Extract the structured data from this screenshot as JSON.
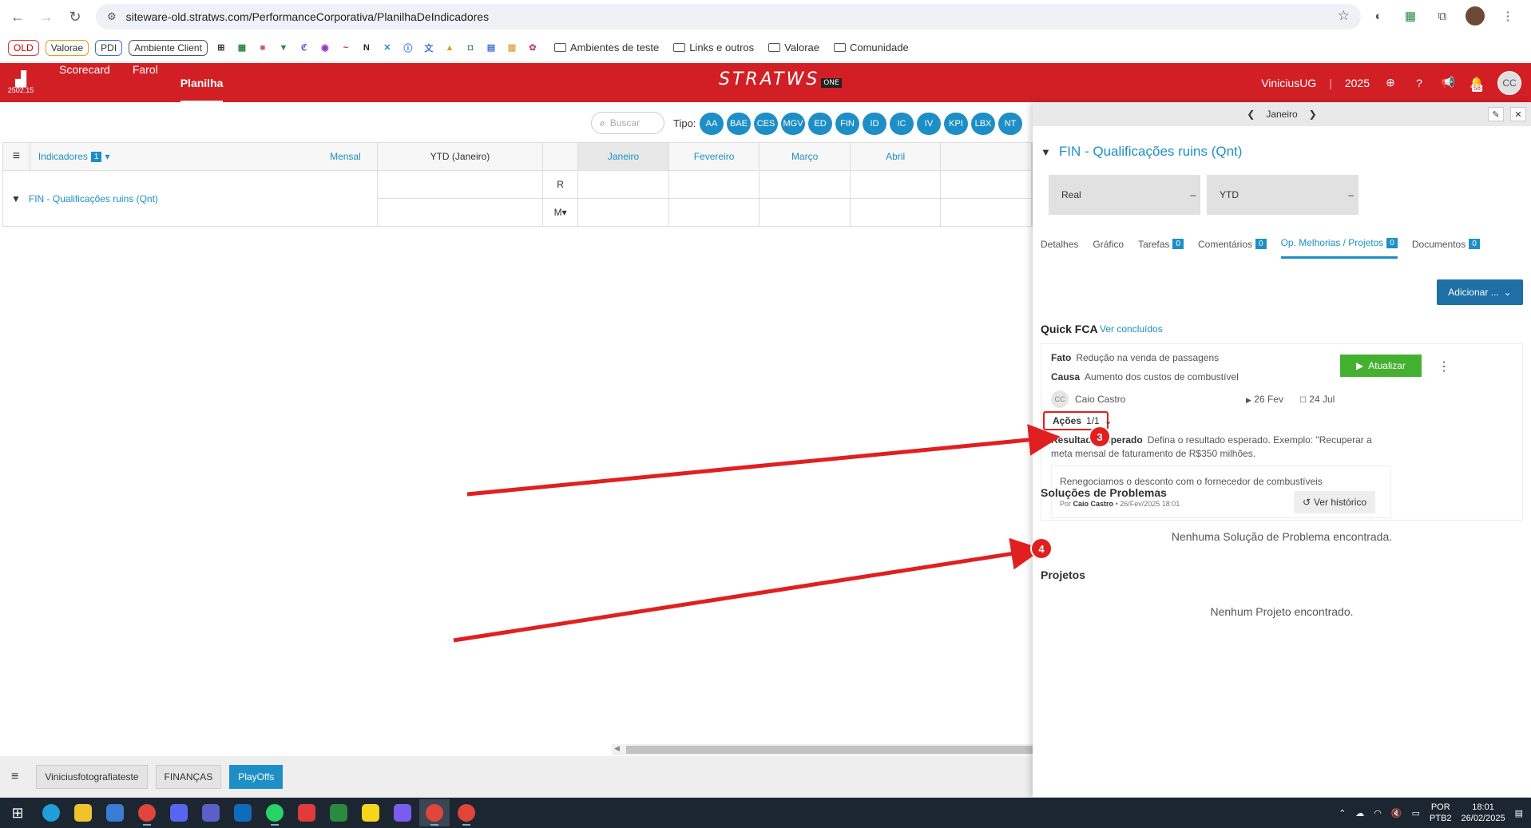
{
  "browser": {
    "url": "siteware-old.stratws.com/PerformanceCorporativa/PlanilhaDeIndicadores",
    "bookmarks": [
      "OLD",
      "Valorae",
      "PDI",
      "Ambiente Client"
    ],
    "bookmark_folders": [
      "Ambientes de teste",
      "Links e outros",
      "Valorae",
      "Comunidade"
    ]
  },
  "header": {
    "logo_caption": "2502.15",
    "nav": [
      "Scorecard",
      "Farol",
      "Planilha"
    ],
    "brand": "STRATWS",
    "brand_sub": "ONE",
    "user": "ViniciusUG",
    "year": "2025",
    "notifications": "58",
    "avatar": "CC"
  },
  "filters": {
    "search_placeholder": "Buscar",
    "tipo_label": "Tipo:",
    "chips": [
      "AA",
      "BAE",
      "CES",
      "MGV",
      "ED",
      "FIN",
      "ID",
      "IC",
      "IV",
      "KPI",
      "LBX",
      "NT"
    ]
  },
  "grid": {
    "indicators_label": "Indicadores",
    "indicators_count": "1",
    "period": "Mensal",
    "ytd_header": "YTD (Janeiro)",
    "months": [
      "Janeiro",
      "Fevereiro",
      "Março",
      "Abril"
    ],
    "row_name": "FIN - Qualificações ruins (Qnt)",
    "row_r": "R",
    "row_m": "M▾"
  },
  "sheets": [
    "Viniciusfotografiateste",
    "FINANÇAS",
    "PlayOffs"
  ],
  "panel": {
    "month": "Janeiro",
    "title": "FIN - Qualificações ruins (Qnt)",
    "real_label": "Real",
    "real_value": "–",
    "ytd_label": "YTD",
    "ytd_value": "–",
    "tabs": [
      {
        "label": "Detalhes",
        "count": ""
      },
      {
        "label": "Gráfico",
        "count": ""
      },
      {
        "label": "Tarefas",
        "count": "0"
      },
      {
        "label": "Comentários",
        "count": "0"
      },
      {
        "label": "Op. Melhorias / Projetos",
        "count": "0"
      },
      {
        "label": "Documentos",
        "count": "0"
      }
    ],
    "add_button": "Adicionar ...",
    "quick_fca": "Quick FCA",
    "see_done": "Ver concluídos",
    "fato_label": "Fato",
    "fato": "Redução na venda de passagens",
    "causa_label": "Causa",
    "causa": "Aumento dos custos de combustível",
    "update_button": "Atualizar",
    "owner_initials": "CC",
    "owner": "Caio Castro",
    "start_date": "26 Fev",
    "end_date": "24 Jul",
    "acoes_label": "Ações",
    "acoes_count": "1/1",
    "result_label": "Resultado esperado",
    "result_text": "Defina o resultado esperado. Exemplo: \"Recuperar a meta mensal de faturamento de R$350 milhões.",
    "action_text": "Renegociamos o desconto com o fornecedor de combustíveis",
    "action_by_prefix": "Por",
    "action_by": "Caio Castro",
    "action_when": "• 26/Fev/2025 18:01",
    "history_button": "Ver histórico",
    "solutions_title": "Soluções de Problemas",
    "solutions_empty": "Nenhuma Solução de Problema encontrada.",
    "projects_title": "Projetos",
    "projects_empty": "Nenhum Projeto encontrado."
  },
  "annotations": {
    "marker_1": "3",
    "marker_2": "4",
    "color": "#e02020"
  },
  "taskbar": {
    "lang": "POR",
    "layout": "PTB2",
    "time": "18:01",
    "date": "26/02/2025"
  },
  "colors": {
    "brand_red": "#d21f26",
    "link_blue": "#1e8fc6",
    "success_green": "#44b030"
  }
}
